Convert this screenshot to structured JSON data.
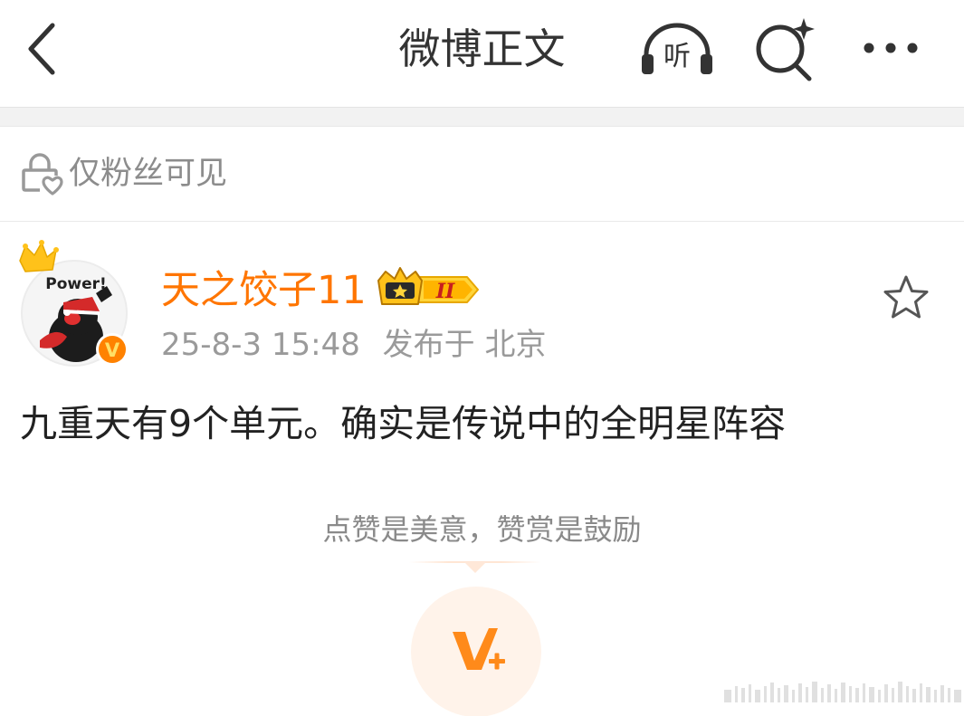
{
  "nav": {
    "title": "微博正文",
    "listen_glyph": "听",
    "back_icon": "chevron-left-icon",
    "search_icon": "ai-search-icon",
    "more_icon": "more-dots-icon"
  },
  "visibility": {
    "label": "仅粉丝可见",
    "icon": "lock-heart-icon"
  },
  "author": {
    "name": "天之饺子11",
    "avatar_text": "Power!",
    "verified_glyph": "V",
    "badge_numeral": "II",
    "timestamp": "25-8-3 15:48",
    "source": "发布于 北京"
  },
  "post": {
    "text": "九重天有9个单元。确实是传说中的全明星阵容"
  },
  "reward": {
    "caption": "点赞是美意，赞赏是鼓励",
    "icon": "v-plus-icon"
  },
  "colors": {
    "accent": "#ff7500",
    "verified": "#ff8200",
    "muted_text": "#9a9a9a",
    "body_text": "#222222",
    "reward_bg": "#fff3ea"
  }
}
